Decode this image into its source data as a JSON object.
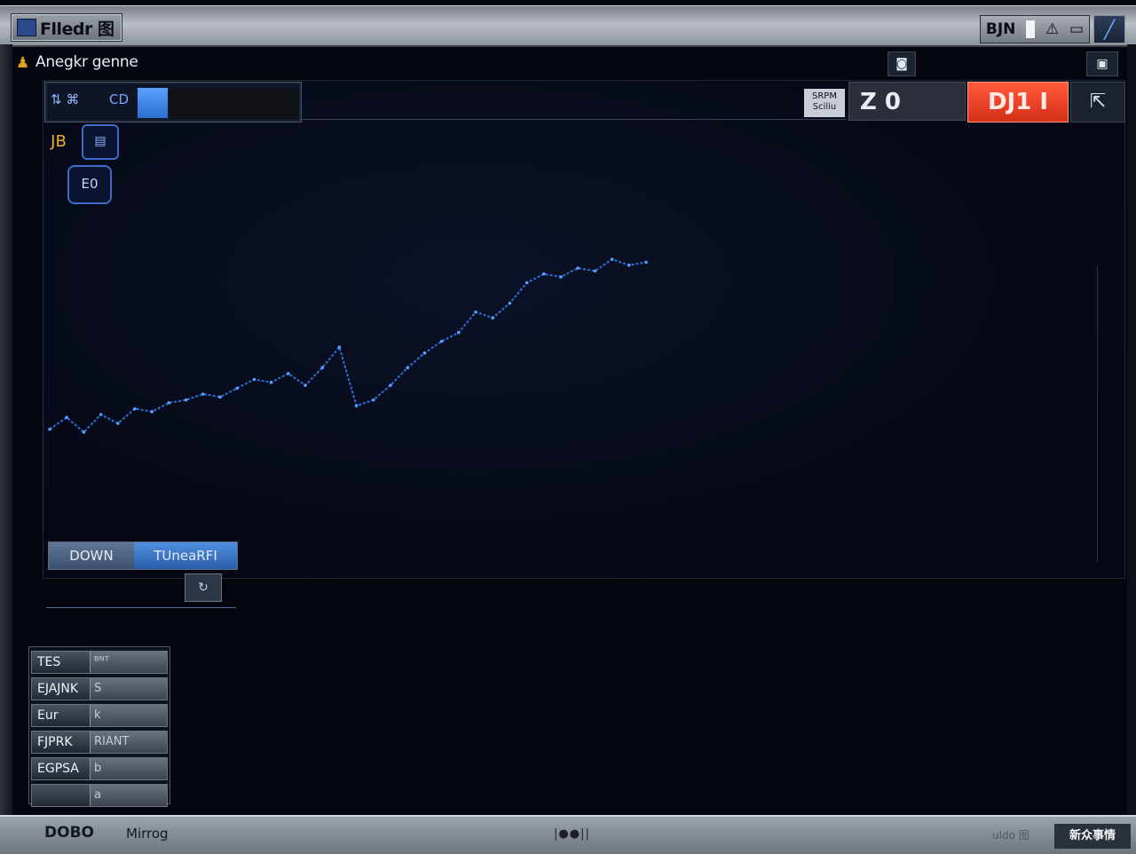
{
  "window": {
    "title": "Flledr 图",
    "controls_label": "BJN",
    "controls_extra": "⚠"
  },
  "app": {
    "title": "Anegkr genne"
  },
  "toolbar": {
    "left_icons": "⇅ ⌘",
    "left_label": "CD",
    "side_badge": "JB",
    "side_chip": "▤",
    "side_tag": "E0",
    "mini_label_top": "SRPM",
    "mini_label_bottom": "Sciliu",
    "counter": "Z 0",
    "alert": "DJ1 I",
    "share_icon": "⇱"
  },
  "chart_data": {
    "type": "line",
    "title": "",
    "xlabel": "",
    "ylabel": "",
    "x": [
      0,
      1,
      2,
      3,
      4,
      5,
      6,
      7,
      8,
      9,
      10,
      11,
      12,
      13,
      14,
      15,
      16,
      17,
      18,
      19,
      20,
      21,
      22,
      23,
      24,
      25,
      26,
      27,
      28,
      29,
      30,
      31,
      32,
      33,
      34,
      35
    ],
    "series": [
      {
        "values": [
          5,
          9,
          4,
          10,
          7,
          12,
          11,
          14,
          15,
          17,
          16,
          19,
          22,
          21,
          24,
          20,
          26,
          33,
          13,
          15,
          20,
          26,
          31,
          35,
          38,
          45,
          43,
          48,
          55,
          58,
          57,
          60,
          59,
          63,
          61,
          62
        ],
        "color": "#2f6fd8"
      }
    ],
    "ylim": [
      0,
      100
    ],
    "grid": false
  },
  "range_control": {
    "option_a": "DOWN",
    "option_b": "TUneaRFI",
    "icon": "↻"
  },
  "list": [
    {
      "key": "TES",
      "value": "ᴮᴺᵀ"
    },
    {
      "key": "EJAJNK",
      "value": "S"
    },
    {
      "key": "Eur",
      "value": "k"
    },
    {
      "key": "FJPRK",
      "value": "RIANT"
    },
    {
      "key": "EGPSA",
      "value": "b"
    },
    {
      "key": "",
      "value": "a"
    }
  ],
  "status": {
    "left": "DOBO",
    "mid": "Mirrog",
    "center": "|●●||",
    "right": "uldo 图",
    "badge": "新众事情"
  },
  "colors": {
    "accent": "#2f6fd8",
    "alert": "#e23a20",
    "panel_bg": "#050814"
  }
}
